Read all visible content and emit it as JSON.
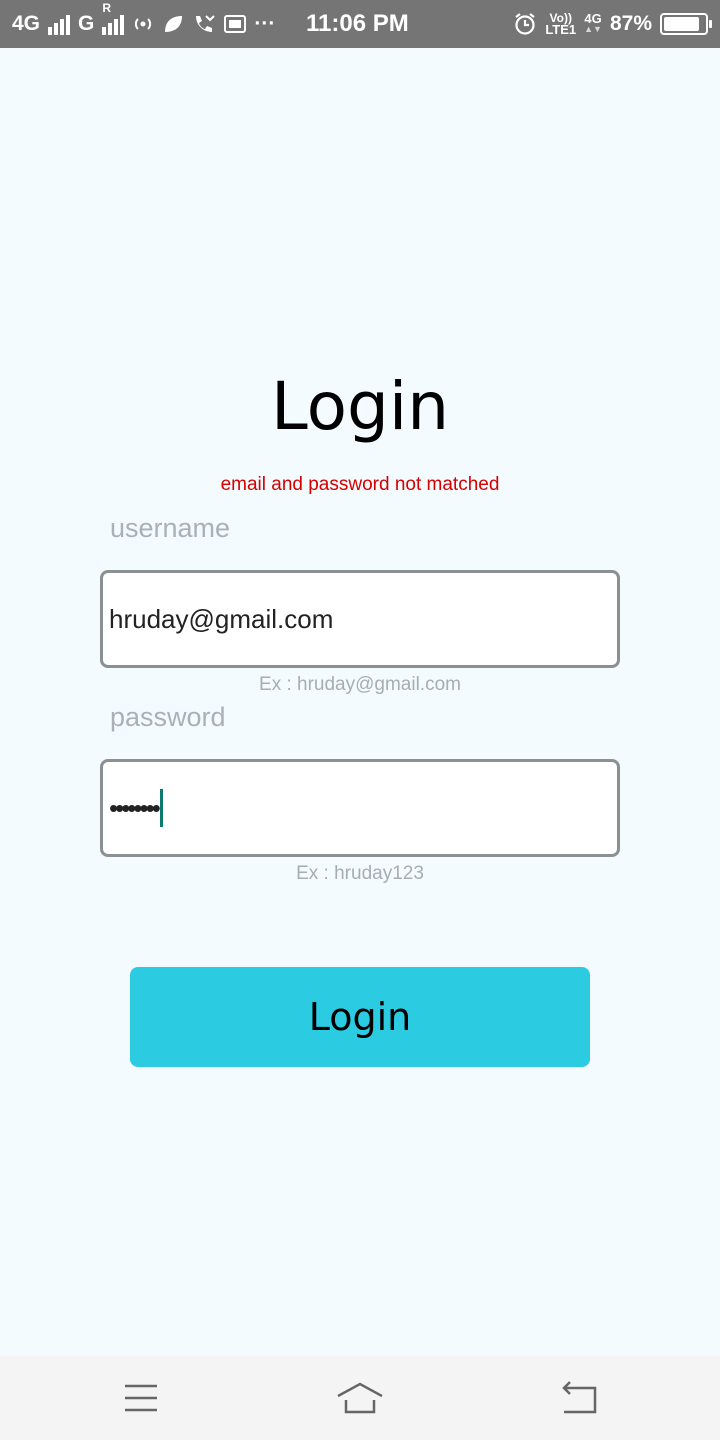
{
  "status_bar": {
    "network_1": "4G",
    "network_2": "G",
    "roaming": "R",
    "more_dots": "···",
    "time": "11:06 PM",
    "volte_top": "Vo))",
    "volte_bottom": "LTE1",
    "network_right": "4G",
    "battery_level_percent": 87,
    "battery_text": "87%"
  },
  "login": {
    "title": "Login",
    "error_message": "email and password not matched",
    "username": {
      "label": "username",
      "value": "hruday@gmail.com",
      "hint": "Ex : hruday@gmail.com"
    },
    "password": {
      "label": "password",
      "value": "••••••••",
      "hint": "Ex : hruday123"
    },
    "button_label": "Login"
  },
  "colors": {
    "background": "#f4fbff",
    "status_bar": "#757575",
    "error": "#d50000",
    "button": "#2bcbe2",
    "field_border": "#8a9191",
    "caret": "#0d7a6e"
  },
  "icons": {
    "nav": [
      "menu-icon",
      "home-icon",
      "back-icon"
    ]
  }
}
